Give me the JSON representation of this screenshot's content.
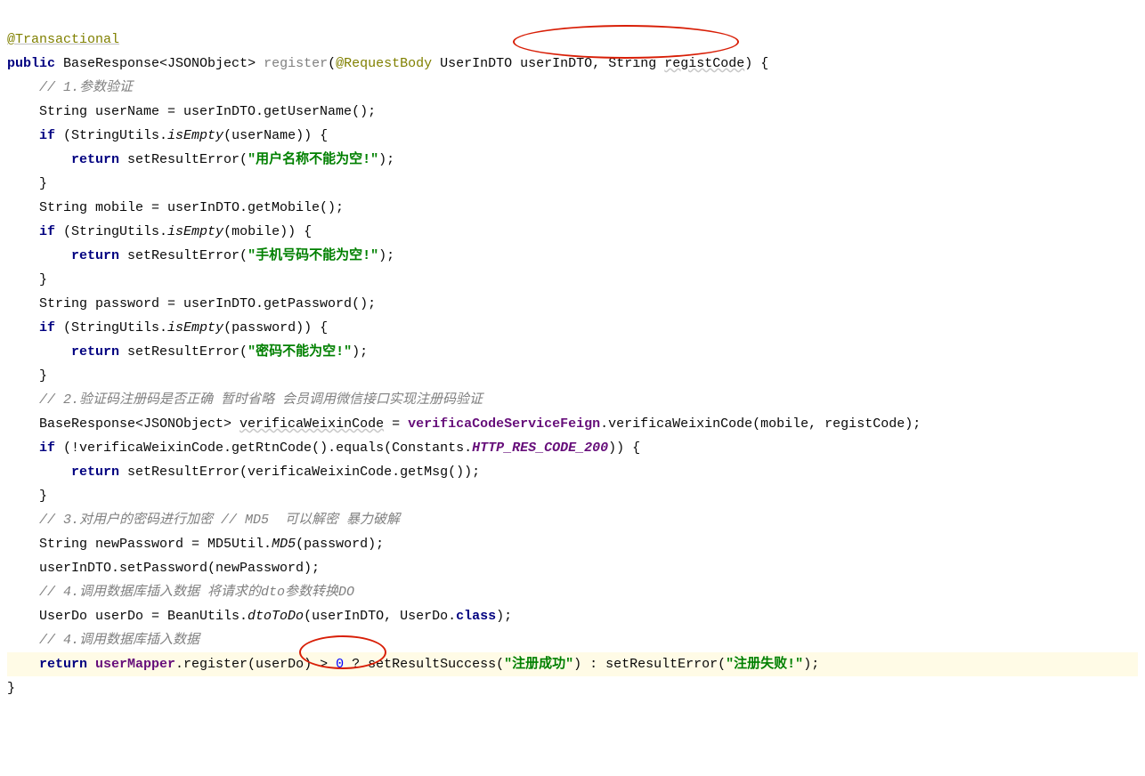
{
  "code": {
    "l1_annotation": "@Transactional",
    "l2_public": "public",
    "l2_type1": "BaseResponse<JSONObject> ",
    "l2_method": "register",
    "l2_p1": "(",
    "l2_ann1": "@RequestBody",
    "l2_sp1": " ",
    "l2_type2": "UserInDTO userInDTO",
    "l2_sep1": ", String ",
    "l2_pname2": "registCode",
    "l2_end": ") {",
    "l3_comment": "    // 1.参数验证",
    "l4_a": "    String userName = userInDTO.getUserName();",
    "l5_if": "    if",
    "l5_rest1": " (StringUtils.",
    "l5_isEmpty": "isEmpty",
    "l5_rest2": "(userName)) {",
    "l6_return": "        return",
    "l6_rest1": " setResultError(",
    "l6_str": "\"用户名称不能为空!\"",
    "l6_rest2": ");",
    "l7_close": "    }",
    "l8_a": "    String mobile = userInDTO.getMobile();",
    "l9_if": "    if",
    "l9_rest1": " (StringUtils.",
    "l9_isEmpty": "isEmpty",
    "l9_rest2": "(mobile)) {",
    "l10_return": "        return",
    "l10_rest1": " setResultError(",
    "l10_str": "\"手机号码不能为空!\"",
    "l10_rest2": ");",
    "l11_close": "    }",
    "l12_a": "    String password = userInDTO.getPassword();",
    "l13_if": "    if",
    "l13_rest1": " (StringUtils.",
    "l13_isEmpty": "isEmpty",
    "l13_rest2": "(password)) {",
    "l14_return": "        return",
    "l14_rest1": " setResultError(",
    "l14_str": "\"密码不能为空!\"",
    "l14_rest2": ");",
    "l15_close": "    }",
    "l16_comment": "    // 2.验证码注册码是否正确 暂时省略 会员调用微信接口实现注册码验证",
    "l17_a": "    BaseResponse<JSONObject> ",
    "l17_var": "verificaWeixinCode",
    "l17_b": " = ",
    "l17_field": "verificaCodeServiceFeign",
    "l17_c": ".verificaWeixinCode(mobile, registCode);",
    "l18_if": "    if",
    "l18_rest1": " (!verificaWeixinCode.getRtnCode().equals(Constants.",
    "l18_const": "HTTP_RES_CODE_200",
    "l18_rest2": ")) {",
    "l19_return": "        return",
    "l19_rest": " setResultError(verificaWeixinCode.getMsg());",
    "l20_close": "    }",
    "l21_comment": "    // 3.对用户的密码进行加密 // MD5  可以解密 暴力破解",
    "l22_a": "    String newPassword = MD5Util.",
    "l22_md5": "MD5",
    "l22_b": "(password);",
    "l23_a": "    userInDTO.setPassword(newPassword);",
    "l24_comment": "    // 4.调用数据库插入数据 将请求的dto参数转换DO",
    "l25_a": "    UserDo userDo = BeanUtils.",
    "l25_dtoToDo": "dtoToDo",
    "l25_b": "(userInDTO, UserDo.",
    "l25_class": "class",
    "l25_c": ");",
    "l26_comment": "    // 4.调用数据库插入数据",
    "l27_return": "    return",
    "l27_sp": " ",
    "l27_field": "userMapper",
    "l27_rest1": ".register(userDo) > ",
    "l27_zero": "0",
    "l27_rest2": " ? setResultSuccess(",
    "l27_str1": "\"注册成功\"",
    "l27_rest3": ") : setResultError(",
    "l27_str2": "\"注册失败!\"",
    "l27_rest4": ");",
    "l28_close": "}"
  }
}
